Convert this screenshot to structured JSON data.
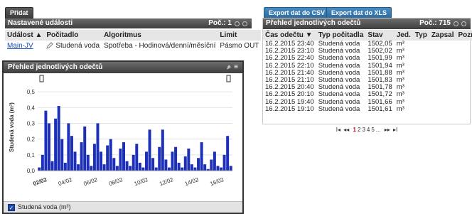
{
  "top": {
    "add_label": "Přidat",
    "export_csv_label": "Export dat do CSV",
    "export_xls_label": "Export dat do XLS"
  },
  "events_panel": {
    "title": "Nastavené události",
    "count_label": "Poč.: 1",
    "headers": [
      "Událost ▲",
      "Počitadlo",
      "Algoritmus",
      "Limit"
    ],
    "row": {
      "event": "Main-JV",
      "counter": "Studená voda",
      "algorithm": "Spotřeba - Hodinová/denní/měsíční",
      "limit": "Pásmo OUT"
    }
  },
  "chart_panel": {
    "title": "Přehled jednotlivých odečtů",
    "legend_label": "Studená voda (m³)",
    "series_color": "#1c2fb8"
  },
  "readings_panel": {
    "title": "Přehled jednotlivých odečtů",
    "count_label": "Poč.: 715",
    "headers": [
      "Čas odečtu ▼",
      "Typ počitadla",
      "Stav",
      "Jed.",
      "Typ",
      "Zapsal",
      "Pozn."
    ],
    "rows": [
      {
        "time": "16.2.2015 23:40",
        "type": "Studená voda",
        "value": "1502,05",
        "unit": "m³"
      },
      {
        "time": "16.2.2015 23:10",
        "type": "Studená voda",
        "value": "1502,02",
        "unit": "m³"
      },
      {
        "time": "16.2.2015 22:40",
        "type": "Studená voda",
        "value": "1501,99",
        "unit": "m³"
      },
      {
        "time": "16.2.2015 22:10",
        "type": "Studená voda",
        "value": "1501,94",
        "unit": "m³"
      },
      {
        "time": "16.2.2015 21:40",
        "type": "Studená voda",
        "value": "1501,88",
        "unit": "m³"
      },
      {
        "time": "16.2.2015 21:10",
        "type": "Studená voda",
        "value": "1501,83",
        "unit": "m³"
      },
      {
        "time": "16.2.2015 20:40",
        "type": "Studená voda",
        "value": "1501,78",
        "unit": "m³"
      },
      {
        "time": "16.2.2015 20:10",
        "type": "Studená voda",
        "value": "1501,72",
        "unit": "m³"
      },
      {
        "time": "16.2.2015 19:40",
        "type": "Studená voda",
        "value": "1501,66",
        "unit": "m³"
      },
      {
        "time": "16.2.2015 19:10",
        "type": "Studená voda",
        "value": "1501,61",
        "unit": "m³"
      }
    ],
    "pager": {
      "first": "I◂",
      "prev": "◂◂",
      "pages": [
        "1",
        "2",
        "3",
        "4",
        "5",
        "..."
      ],
      "current": "1",
      "next": "▸▸",
      "last": "▸I"
    }
  },
  "chart_data": {
    "type": "bar",
    "title": "",
    "ylabel": "Studená voda (m³)",
    "xlabel": "",
    "ylim": [
      0,
      0.55
    ],
    "yticks": [
      "0,0",
      "0,1",
      "0,2",
      "0,3",
      "0,4",
      "0,5"
    ],
    "xticks": [
      "02/02",
      "04/02",
      "06/02",
      "08/02",
      "10/02",
      "12/02",
      "14/02",
      "16/02"
    ],
    "x": [
      "02/02",
      "02/02",
      "02/02",
      "02/02",
      "03/02",
      "03/02",
      "03/02",
      "03/02",
      "04/02",
      "04/02",
      "04/02",
      "04/02",
      "05/02",
      "05/02",
      "05/02",
      "05/02",
      "06/02",
      "06/02",
      "06/02",
      "06/02",
      "07/02",
      "07/02",
      "07/02",
      "07/02",
      "08/02",
      "08/02",
      "08/02",
      "08/02",
      "09/02",
      "09/02",
      "09/02",
      "09/02",
      "10/02",
      "10/02",
      "10/02",
      "10/02",
      "11/02",
      "11/02",
      "11/02",
      "11/02",
      "12/02",
      "12/02",
      "12/02",
      "12/02",
      "13/02",
      "13/02",
      "13/02",
      "13/02",
      "14/02",
      "14/02",
      "14/02",
      "14/02",
      "15/02",
      "15/02",
      "15/02",
      "15/02",
      "16/02",
      "16/02",
      "16/02",
      "16/02"
    ],
    "values": [
      0.02,
      0.1,
      0.38,
      0.3,
      0.06,
      0.33,
      0.41,
      0.2,
      0.05,
      0.3,
      0.22,
      0.12,
      0.04,
      0.18,
      0.28,
      0.1,
      0.03,
      0.17,
      0.3,
      0.12,
      0.04,
      0.16,
      0.2,
      0.08,
      0.03,
      0.14,
      0.18,
      0.06,
      0.03,
      0.1,
      0.17,
      0.05,
      0.02,
      0.12,
      0.26,
      0.08,
      0.02,
      0.15,
      0.26,
      0.07,
      0.02,
      0.12,
      0.15,
      0.05,
      0.02,
      0.09,
      0.14,
      0.04,
      0.02,
      0.08,
      0.18,
      0.04,
      0.01,
      0.07,
      0.12,
      0.03,
      0.02,
      0.1,
      0.22,
      0.03
    ],
    "series": [
      {
        "name": "Studená voda (m³)"
      }
    ],
    "grid": true
  }
}
